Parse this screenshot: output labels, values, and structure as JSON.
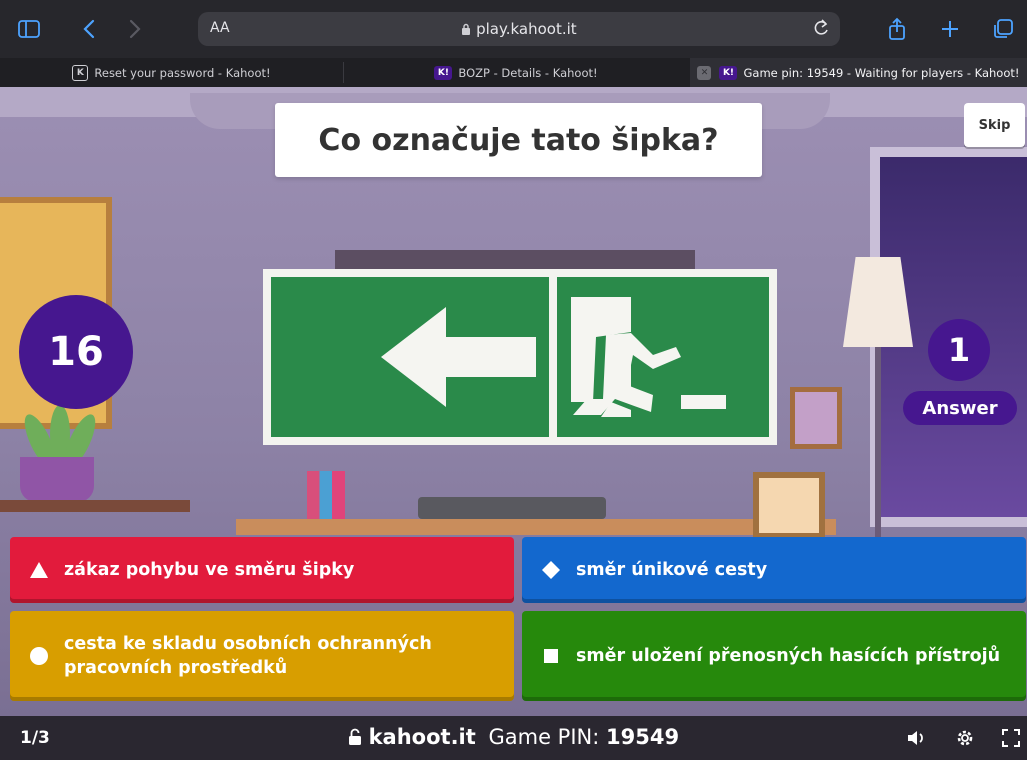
{
  "browser": {
    "address_small": "AA",
    "url": "play.kahoot.it",
    "tabs": [
      {
        "label": "Reset your password - Kahoot!",
        "icon_char": "K"
      },
      {
        "label": "BOZP - Details - Kahoot!",
        "icon_char": "K!"
      },
      {
        "label": "Game pin: 19549 - Waiting for players - Kahoot!",
        "icon_char": "K!"
      }
    ]
  },
  "game": {
    "question": "Co označuje tato šipka?",
    "skip_label": "Skip",
    "timer": "16",
    "answer_count": "1",
    "answer_count_label": "Answer",
    "answers": [
      {
        "label": "zákaz pohybu ve směru šipky",
        "shape": "triangle-icon"
      },
      {
        "label": "směr únikové cesty",
        "shape": "diamond-icon"
      },
      {
        "label": "cesta ke skladu osobních ochranných pracovních prostředků",
        "shape": "circle-icon"
      },
      {
        "label": "směr uložení přenosných hasících přístrojů",
        "shape": "square-icon"
      }
    ]
  },
  "footer": {
    "progress": "1/3",
    "site": "kahoot.it",
    "pin_label": "Game PIN:",
    "pin": "19549"
  },
  "colors": {
    "red": "#e21b3c",
    "blue": "#1368ce",
    "yellow": "#d89e00",
    "green": "#26890c",
    "purple": "#46178f"
  }
}
